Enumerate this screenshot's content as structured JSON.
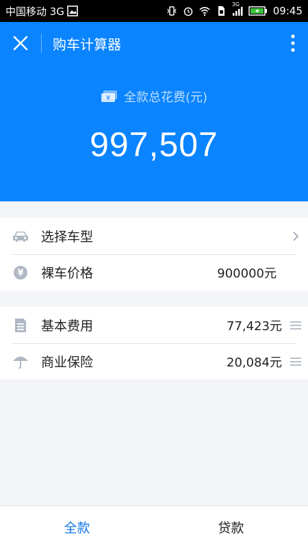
{
  "status_bar": {
    "carrier": "中国移动 3G",
    "network_badge": "3G",
    "time": "09:45",
    "icons": [
      "gallery-icon",
      "vibrate-icon",
      "alarm-icon",
      "wifi-icon",
      "sim-icon",
      "signal-icon",
      "battery-icon"
    ]
  },
  "app_bar": {
    "title": "购车计算器",
    "close_icon": "close-icon",
    "more_icon": "more-vertical-icon"
  },
  "summary": {
    "label": "全款总花费(元)",
    "total": "997,507",
    "icon": "cash-icon"
  },
  "car_group": [
    {
      "label": "选择车型",
      "value": "",
      "icon": "car-icon",
      "trail": "chevron-right-icon"
    },
    {
      "label": "裸车价格",
      "value": "900000元",
      "icon": "yen-icon",
      "trail": ""
    }
  ],
  "cost_group": [
    {
      "label": "基本费用",
      "value": "77,423元",
      "icon": "document-icon",
      "trail": "list-icon"
    },
    {
      "label": "商业保险",
      "value": "20,084元",
      "icon": "umbrella-icon",
      "trail": "list-icon"
    }
  ],
  "tabs": [
    {
      "label": "全款",
      "active": true
    },
    {
      "label": "贷款",
      "active": false
    }
  ],
  "colors": {
    "primary": "#0a84ff",
    "active_tab": "#1477e6",
    "background": "#f4f5f8",
    "icon_gray": "#b0b8c4"
  }
}
